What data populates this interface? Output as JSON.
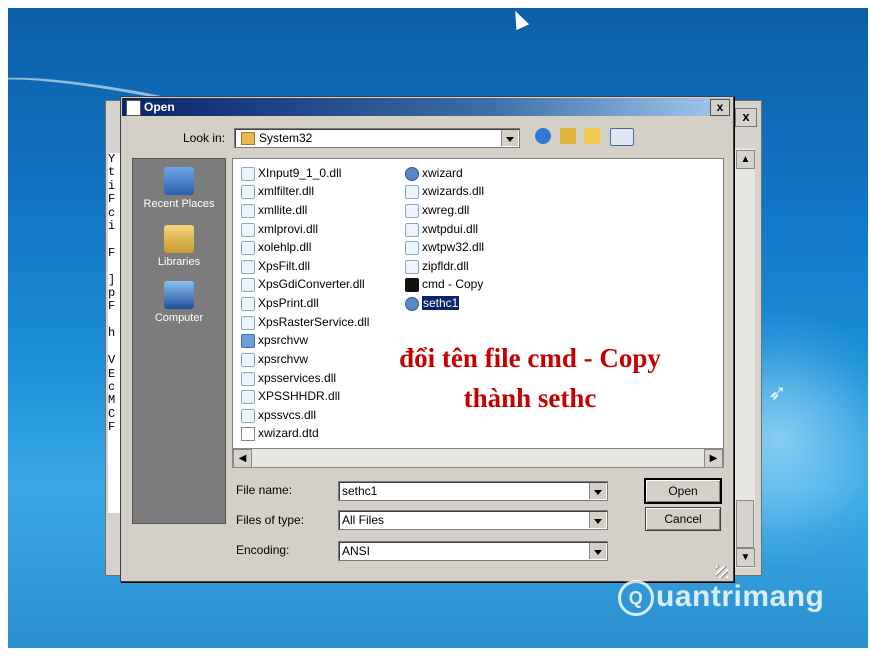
{
  "dialog": {
    "title": "Open",
    "look_in_label": "Look in:",
    "look_in_value": "System32",
    "file_name_label": "File name:",
    "file_name_value": "sethc1",
    "files_of_type_label": "Files of type:",
    "files_of_type_value": "All Files",
    "encoding_label": "Encoding:",
    "encoding_value": "ANSI",
    "open_button": "Open",
    "cancel_button": "Cancel",
    "close_glyph": "x"
  },
  "places": [
    "Recent Places",
    "Libraries",
    "Computer"
  ],
  "files_col1": [
    "XInput9_1_0.dll",
    "xmlfilter.dll",
    "xmllite.dll",
    "xmlprovi.dll",
    "xolehlp.dll",
    "XpsFilt.dll",
    "XpsGdiConverter.dll",
    "XpsPrint.dll",
    "XpsRasterService.dll",
    "xpsrchvw",
    "xpsrchvw",
    "xpsservices.dll",
    "XPSSHHDR.dll",
    "xpssvcs.dll",
    "xwizard.dtd"
  ],
  "files_col2": [
    "xwizard",
    "xwizards.dll",
    "xwreg.dll",
    "xwtpdui.dll",
    "xwtpw32.dll",
    "zipfldr.dll",
    "cmd - Copy",
    "sethc1"
  ],
  "selected_file": "sethc1",
  "overlay_text": [
    "đổi tên file cmd - Copy",
    "thành sethc"
  ],
  "notepad": {
    "visible_chars": "Y\nt\ni\nF\nc\ni\n \nF\n \n]\np\nF\n \nh\n \nV\nE\nc\nM\nC\nF",
    "close_glyph": "x"
  },
  "watermark": "uantrimang",
  "colors": {
    "overlay": "#c40000",
    "titlebar": "#0a246a",
    "selection": "#0a246a"
  }
}
